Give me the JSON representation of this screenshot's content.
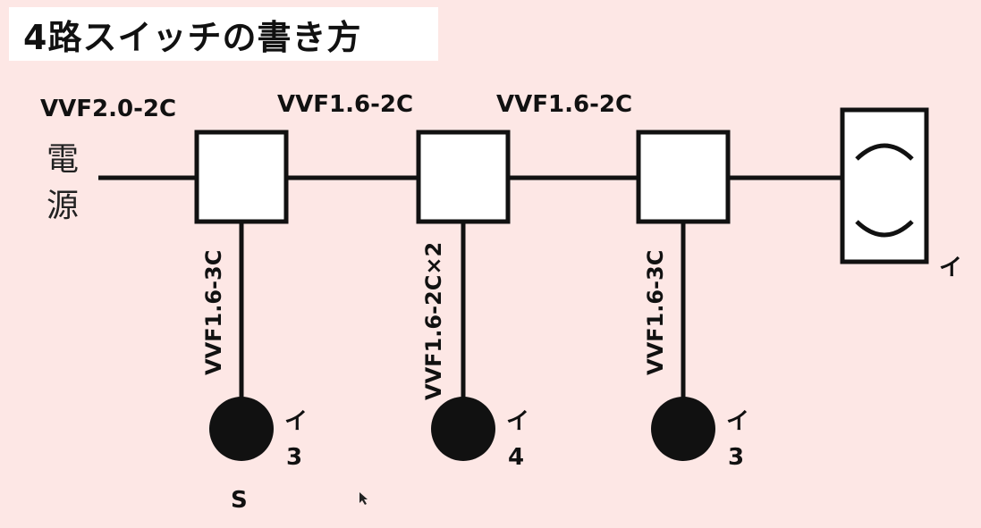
{
  "title": "4路スイッチの書き方",
  "power_source": [
    "電",
    "源"
  ],
  "cables": {
    "feed": "VVF2.0-2C",
    "span1": "VVF1.6-2C",
    "span2": "VVF1.6-2C",
    "drop1": "VVF1.6-3C",
    "drop2": "VVF1.6-2C×2",
    "drop3": "VVF1.6-3C"
  },
  "lamp_label": "イ",
  "switches": [
    {
      "label_top": "イ",
      "label_bottom": "3",
      "extra": "S"
    },
    {
      "label_top": "イ",
      "label_bottom": "4"
    },
    {
      "label_top": "イ",
      "label_bottom": "3"
    }
  ],
  "colors": {
    "background": "#fde7e5",
    "line": "#111111",
    "box_fill": "#ffffff"
  }
}
